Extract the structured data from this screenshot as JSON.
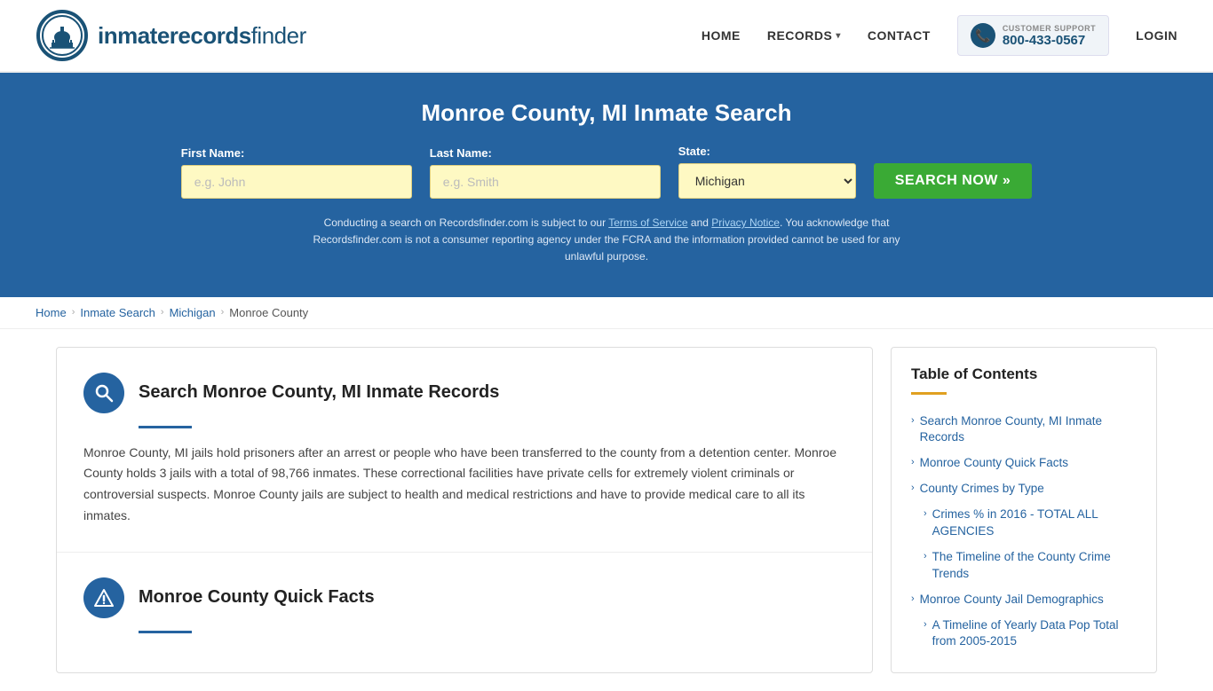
{
  "header": {
    "logo_text_light": "inmaterecords",
    "logo_text_bold": "finder",
    "nav": {
      "home": "HOME",
      "records": "RECORDS",
      "records_chevron": "▾",
      "contact": "CONTACT",
      "login": "LOGIN"
    },
    "support": {
      "label": "CUSTOMER SUPPORT",
      "number": "800-433-0567"
    }
  },
  "hero": {
    "title": "Monroe County, MI Inmate Search",
    "form": {
      "first_name_label": "First Name:",
      "first_name_placeholder": "e.g. John",
      "last_name_label": "Last Name:",
      "last_name_placeholder": "e.g. Smith",
      "state_label": "State:",
      "state_value": "Michigan",
      "search_btn": "SEARCH NOW »"
    },
    "disclaimer": "Conducting a search on Recordsfinder.com is subject to our Terms of Service and Privacy Notice. You acknowledge that Recordsfinder.com is not a consumer reporting agency under the FCRA and the information provided cannot be used for any unlawful purpose."
  },
  "breadcrumb": {
    "home": "Home",
    "inmate_search": "Inmate Search",
    "michigan": "Michigan",
    "current": "Monroe County"
  },
  "sections": [
    {
      "id": "search-records",
      "icon": "🔍",
      "title": "Search Monroe County, MI Inmate Records",
      "body": "Monroe County, MI jails hold prisoners after an arrest or people who have been transferred to the county from a detention center. Monroe County holds 3 jails with a total of 98,766 inmates. These correctional facilities have private cells for extremely violent criminals or controversial suspects. Monroe County jails are subject to health and medical restrictions and have to provide medical care to all its inmates."
    },
    {
      "id": "quick-facts",
      "icon": "⚠",
      "title": "Monroe County Quick Facts",
      "body": ""
    }
  ],
  "toc": {
    "title": "Table of Contents",
    "items": [
      {
        "label": "Search Monroe County, MI Inmate Records",
        "sub": false
      },
      {
        "label": "Monroe County Quick Facts",
        "sub": false
      },
      {
        "label": "County Crimes by Type",
        "sub": false
      },
      {
        "label": "Crimes % in 2016 - TOTAL ALL AGENCIES",
        "sub": true
      },
      {
        "label": "The Timeline of the County Crime Trends",
        "sub": true
      },
      {
        "label": "Monroe County Jail Demographics",
        "sub": false
      },
      {
        "label": "A Timeline of Yearly Data Pop Total from 2005-2015",
        "sub": true
      }
    ]
  }
}
